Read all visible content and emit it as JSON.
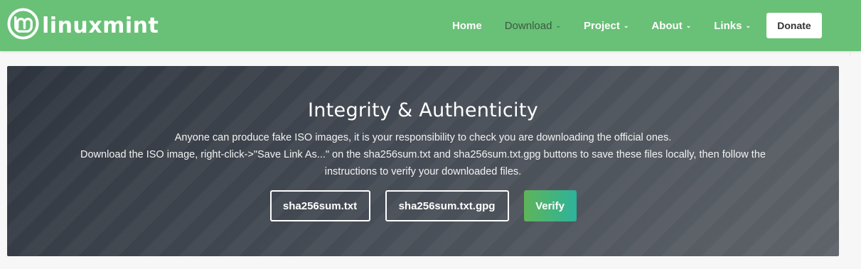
{
  "brand": {
    "name": "linuxmint",
    "logo_icon": "linux-mint-logo-icon"
  },
  "nav": {
    "items": [
      {
        "label": "Home",
        "has_dropdown": false,
        "active": false
      },
      {
        "label": "Download",
        "has_dropdown": true,
        "active": true
      },
      {
        "label": "Project",
        "has_dropdown": true,
        "active": false
      },
      {
        "label": "About",
        "has_dropdown": true,
        "active": false
      },
      {
        "label": "Links",
        "has_dropdown": true,
        "active": false
      }
    ],
    "donate_label": "Donate"
  },
  "hero": {
    "title": "Integrity & Authenticity",
    "line1": "Anyone can produce fake ISO images, it is your responsibility to check you are downloading the official ones.",
    "line2": "Download the ISO image, right-click->\"Save Link As...\" on the sha256sum.txt and sha256sum.txt.gpg buttons to save these files locally, then follow the instructions to verify your downloaded files.",
    "buttons": {
      "sha": "sha256sum.txt",
      "gpg": "sha256sum.txt.gpg",
      "verify": "Verify"
    }
  },
  "colors": {
    "navbar_green": "#69c077",
    "active_nav_text": "#3b5a3e",
    "hero_dark": "#2e343d",
    "verify_gradient_start": "#5fb45a",
    "verify_gradient_end": "#2db39a"
  }
}
